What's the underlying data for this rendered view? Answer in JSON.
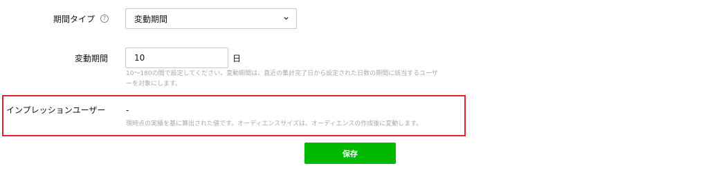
{
  "period_type": {
    "label": "期間タイプ",
    "help_icon_text": "?",
    "selected_value": "変動期間"
  },
  "variable_period": {
    "label": "変動期間",
    "input_value": "10",
    "unit": "日",
    "help_line1": "10〜180の間で設定してください。変動期間は、直近の集計完了日から設定された日数の期間に該当するユーザ",
    "help_line2": "ーを対象にします。"
  },
  "impression_users": {
    "label": "インプレッションユーザー",
    "value": "-",
    "help": "現時点の実績を基に算出された値です。オーディエンスサイズは、オーディエンスの作成後に変動します。"
  },
  "save_button": {
    "label": "保存"
  },
  "colors": {
    "accent_green": "#00b900",
    "highlight_red": "#e0242f",
    "help_gray": "#a9a9a9"
  }
}
